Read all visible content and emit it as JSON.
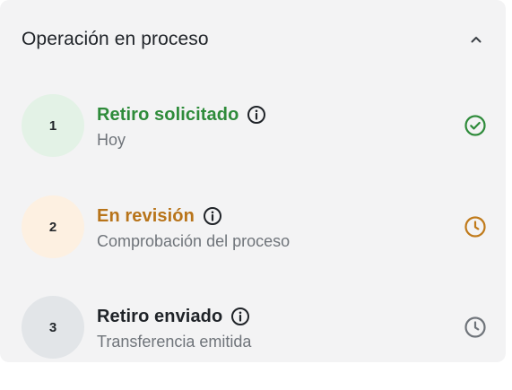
{
  "header": {
    "title": "Operación en proceso",
    "collapse_icon": "chevron-up-icon"
  },
  "steps": [
    {
      "number": "1",
      "title": "Retiro solicitado",
      "subtitle": "Hoy",
      "title_color": "#2e8b3a",
      "circle_color": "#e3f2e6",
      "status_icon": "check-circle-icon",
      "status_color": "#2e8b3a"
    },
    {
      "number": "2",
      "title": "En revisión",
      "subtitle": "Comprobación del proceso",
      "title_color": "#b8741a",
      "circle_color": "#fdf0e1",
      "status_icon": "clock-icon",
      "status_color": "#c07a1a"
    },
    {
      "number": "3",
      "title": "Retiro enviado",
      "subtitle": "Transferencia emitida",
      "title_color": "#1f2328",
      "circle_color": "#e2e5e8",
      "status_icon": "clock-icon",
      "status_color": "#6f747a"
    }
  ]
}
